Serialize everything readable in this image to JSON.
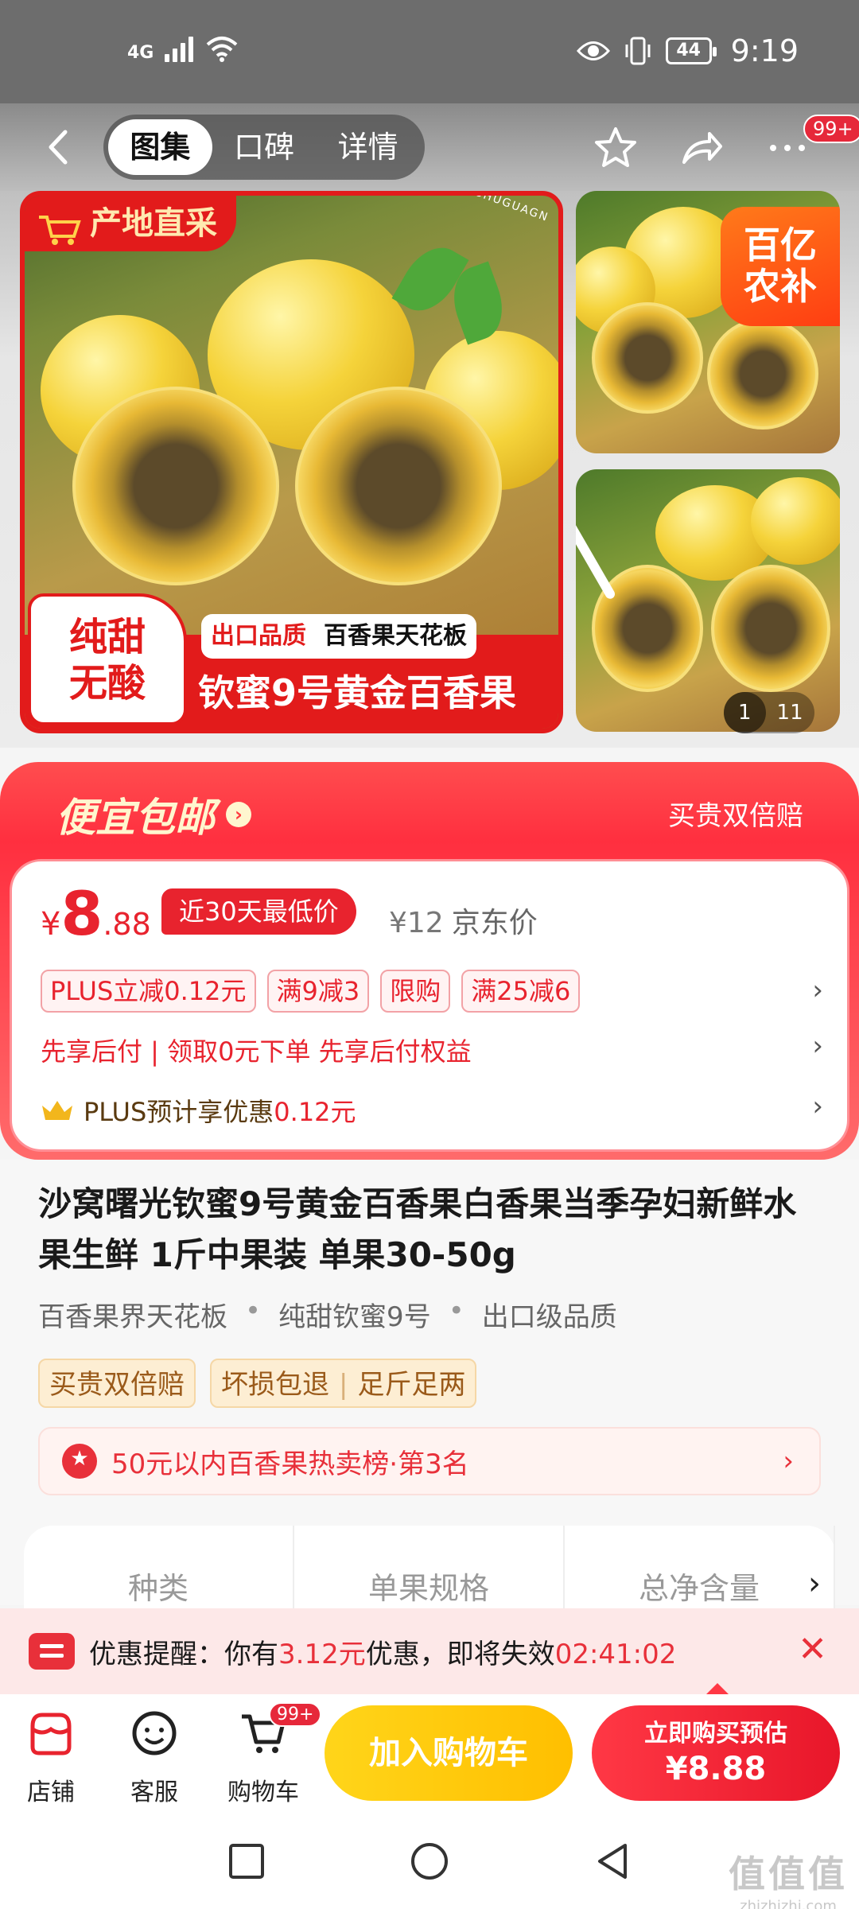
{
  "status_bar": {
    "network": "4G",
    "battery": "44",
    "time": "9:19"
  },
  "nav": {
    "tabs": [
      "图集",
      "口碑",
      "详情"
    ],
    "active_tab": "图集",
    "message_badge": "99+"
  },
  "gallery": {
    "main_banner_top": "产地直采",
    "brand_tag": "SHUGUAGN",
    "sweet_label_line1": "纯甜",
    "sweet_label_line2": "无酸",
    "export_quality": "出口品质",
    "ceiling": "百香果天花板",
    "product_strip": "钦蜜9号黄金百香果",
    "subsidy_line1": "百亿",
    "subsidy_line2": "农补",
    "counter_current": "1",
    "counter_total": "11"
  },
  "promo": {
    "headline": "便宜包邮",
    "right_label": "买贵双倍赔",
    "price_symbol": "¥",
    "price_int": "8",
    "price_dec": ".88",
    "low_tag": "近30天最低价",
    "jd_price": "¥12",
    "jd_label": "京东价",
    "coupons": [
      "PLUS立减0.12元",
      "满9减3",
      "限购",
      "满25减6"
    ],
    "pay_later": "先享后付 | 领取0元下单 先享后付权益",
    "plus_text": "PLUS预计享优惠",
    "plus_amount": "0.12元"
  },
  "product": {
    "title": "沙窝曙光钦蜜9号黄金百香果白香果当季孕妇新鲜水果生鲜 1斤中果装 单果30-50g",
    "tags": [
      "百香果界天花板",
      "纯甜钦蜜9号",
      "出口级品质"
    ],
    "guarantees": [
      "买贵双倍赔",
      "坏损包退",
      "足斤足两"
    ],
    "ranking": "50元以内百香果热卖榜·第3名",
    "spec_columns": [
      "种类",
      "单果规格",
      "总净含量"
    ]
  },
  "reminder": {
    "prefix": "优惠提醒：你有",
    "amount": "3.12元",
    "suffix": "优惠，即将失效",
    "countdown": "02:41:02"
  },
  "actions": {
    "store": "店铺",
    "service": "客服",
    "cart": "购物车",
    "cart_badge": "99+",
    "add_to_cart": "加入购物车",
    "buy_now": "立即购买预估",
    "buy_price": "¥8.88"
  },
  "watermark": {
    "main": "值值值",
    "sub": "zhizhizhi.com"
  },
  "colors": {
    "brand_red": "#e8232e",
    "cart_yellow": "#ffc400",
    "guarantee_bg": "#fdeed3"
  }
}
